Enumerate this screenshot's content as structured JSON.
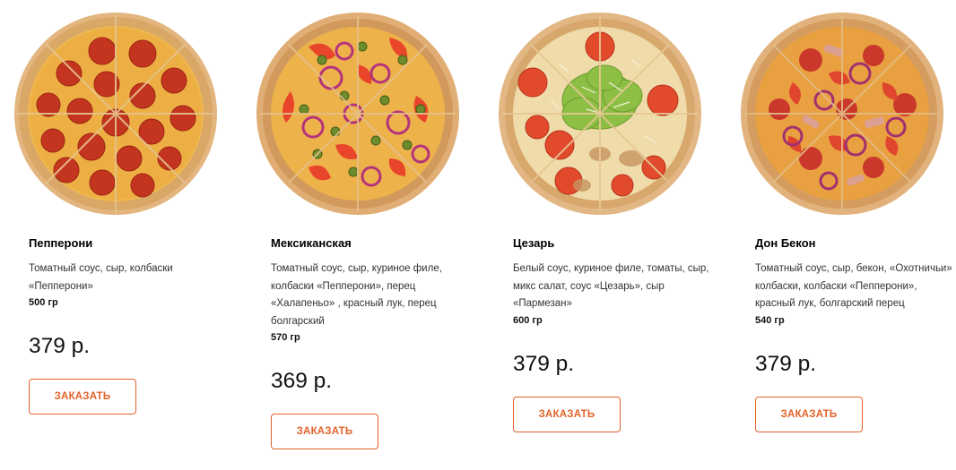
{
  "products": [
    {
      "title": "Пепперони",
      "description": "Томатный соус, сыр, колбаски «Пепперони»",
      "weight": "500 гр",
      "price": "379 р.",
      "order_label": "ЗАКАЗАТЬ",
      "image_name": "pepperoni-pizza-image"
    },
    {
      "title": "Мексиканская",
      "description": "Томатный соус, сыр, куриное филе, колбаски «Пепперони», перец «Халапеньо» , красный лук, перец болгарский",
      "weight": "570 гр",
      "price": "369 р.",
      "order_label": "ЗАКАЗАТЬ",
      "image_name": "mexican-pizza-image"
    },
    {
      "title": "Цезарь",
      "description": "Белый соус, куриное филе, томаты, сыр, микс салат, соус «Цезарь», сыр «Пармезан»",
      "weight": "600 гр",
      "price": "379 р.",
      "order_label": "ЗАКАЗАТЬ",
      "image_name": "caesar-pizza-image"
    },
    {
      "title": "Дон Бекон",
      "description": "Томатный соус, сыр, бекон, «Охотничьи» колбаски, колбаски «Пепперони», красный лук, болгарский перец",
      "weight": "540 гр",
      "price": "379 р.",
      "order_label": "ЗАКАЗАТЬ",
      "image_name": "don-bacon-pizza-image"
    }
  ],
  "colors": {
    "accent": "#e2622a",
    "crust": "#e0b27a",
    "cheese": "#f0c060",
    "pepperoni": "#c9382a",
    "tomato": "#e8432b",
    "onion": "#a8307a",
    "jalapeno": "#6a8a2a",
    "lettuce": "#8fbf4a"
  }
}
